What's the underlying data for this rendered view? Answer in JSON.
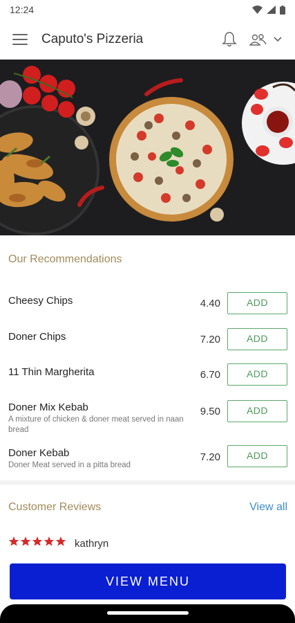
{
  "status_bar": {
    "time": "12:24"
  },
  "app_bar": {
    "title": "Caputo's Pizzeria"
  },
  "recommendations": {
    "title": "Our Recommendations",
    "add_label": "ADD",
    "items": [
      {
        "name": "Cheesy Chips",
        "description": "",
        "price": "4.40"
      },
      {
        "name": "Doner Chips",
        "description": "",
        "price": "7.20"
      },
      {
        "name": "11 Thin Margherita",
        "description": "",
        "price": "6.70"
      },
      {
        "name": "Doner Mix Kebab",
        "description": "A mixture of chicken & doner meat served in naan bread",
        "price": "9.50"
      },
      {
        "name": "Doner Kebab",
        "description": "Doner Meat served in a pitta bread",
        "price": "7.20"
      }
    ]
  },
  "reviews": {
    "title": "Customer Reviews",
    "view_all": "View all",
    "latest": {
      "rating": 5,
      "reviewer": "kathryn"
    }
  },
  "footer": {
    "view_menu": "VIEW MENU"
  },
  "colors": {
    "accent_title": "#a08b5a",
    "add_border": "#5aa86a",
    "link": "#3a8ec9",
    "primary_button": "#0a1fd2",
    "star": "#d42a2a"
  }
}
